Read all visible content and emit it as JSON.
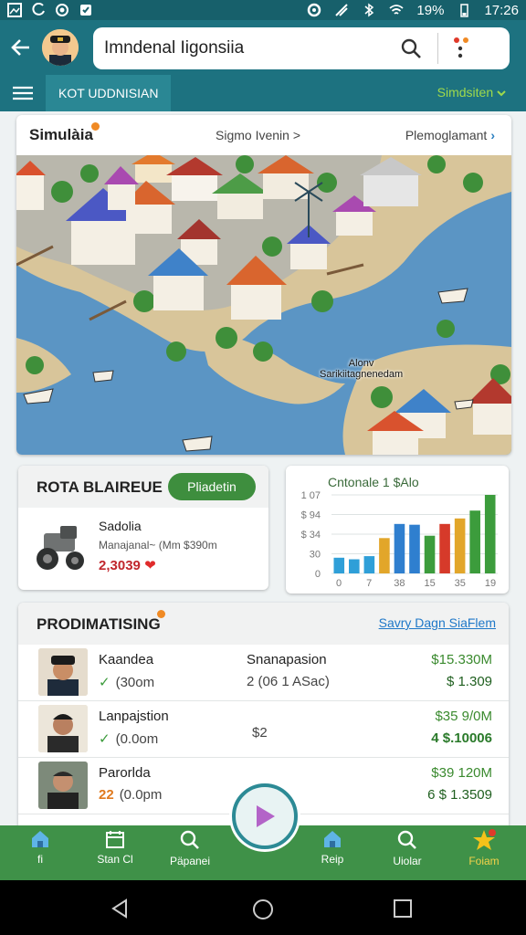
{
  "status_bar": {
    "battery": "19%",
    "time": "17:26"
  },
  "header": {
    "title": "Imndenal Iigonsiia"
  },
  "tabs": {
    "active_label": "KOT UDDNISIAN",
    "right_label": "Simdsiten"
  },
  "simulation": {
    "title": "Simulàia",
    "mid_link": "Sigmo Ivenin >",
    "right_link": "Plemoglamant",
    "map_label_line1": "Alonv",
    "map_label_line2": "Sarikiitagnenedam"
  },
  "rota": {
    "title": "ROTA BLAIREUE",
    "button_label": "Pliadetin",
    "item_name": "Sadolia",
    "item_sub": "Manajanal~ (Mm $390m",
    "item_value": "2,3039"
  },
  "chart_data": {
    "type": "bar",
    "title": "Cntonale 1 $Alo",
    "ytick_labels": [
      "1 07",
      "$ 94",
      "$ 34",
      "30",
      "0"
    ],
    "xtick_labels": [
      "0",
      "7",
      "38",
      "15",
      "35",
      "19"
    ],
    "values": [
      20,
      18,
      22,
      45,
      63,
      62,
      48,
      63,
      70,
      80,
      100
    ],
    "colors": [
      "#2f9fd8",
      "#2f9fd8",
      "#2f9fd8",
      "#e2a62a",
      "#2f7fcf",
      "#2f7fcf",
      "#3c9c3c",
      "#d63a2a",
      "#e2a62a",
      "#3c9c3c",
      "#3c9c3c"
    ],
    "grid": true
  },
  "products": {
    "title": "PRODIMATISING",
    "link": "Savry Dagn SiaFlem",
    "rows": [
      {
        "name": "Kaandea",
        "sub": "(30om",
        "mark": "✓",
        "mid_top": "Snanapasion",
        "mid": "2 (06 1 ASac)",
        "price1": "$15.330M",
        "price2": "$ 1.309"
      },
      {
        "name": "Lanpajstion",
        "sub": "(0.0om",
        "mark": "✓",
        "mid_top": "",
        "mid": "$2",
        "price1": "$35 9/0M",
        "price2": "4 $.10006"
      },
      {
        "name": "Parorlda",
        "sub": "(0.0pm",
        "mark": "22",
        "mid_top": "",
        "mid": "83",
        "price1": "$39 120M",
        "price2": "6 $ 1.3509"
      }
    ]
  },
  "bottom_nav": [
    {
      "label": "fi",
      "icon": "home-icon"
    },
    {
      "label": "Stan Cl",
      "icon": "calendar-icon"
    },
    {
      "label": "Päpanei",
      "icon": "search-icon"
    },
    {
      "label": "Reip",
      "icon": "home-icon"
    },
    {
      "label": "Uiolar",
      "icon": "search-icon"
    },
    {
      "label": "Foiam",
      "icon": "star-icon"
    }
  ],
  "colors": {
    "header": "#1d7280",
    "nav": "#3f9148",
    "accent_green": "#9fd94b",
    "price_green": "#3a8a2e"
  }
}
